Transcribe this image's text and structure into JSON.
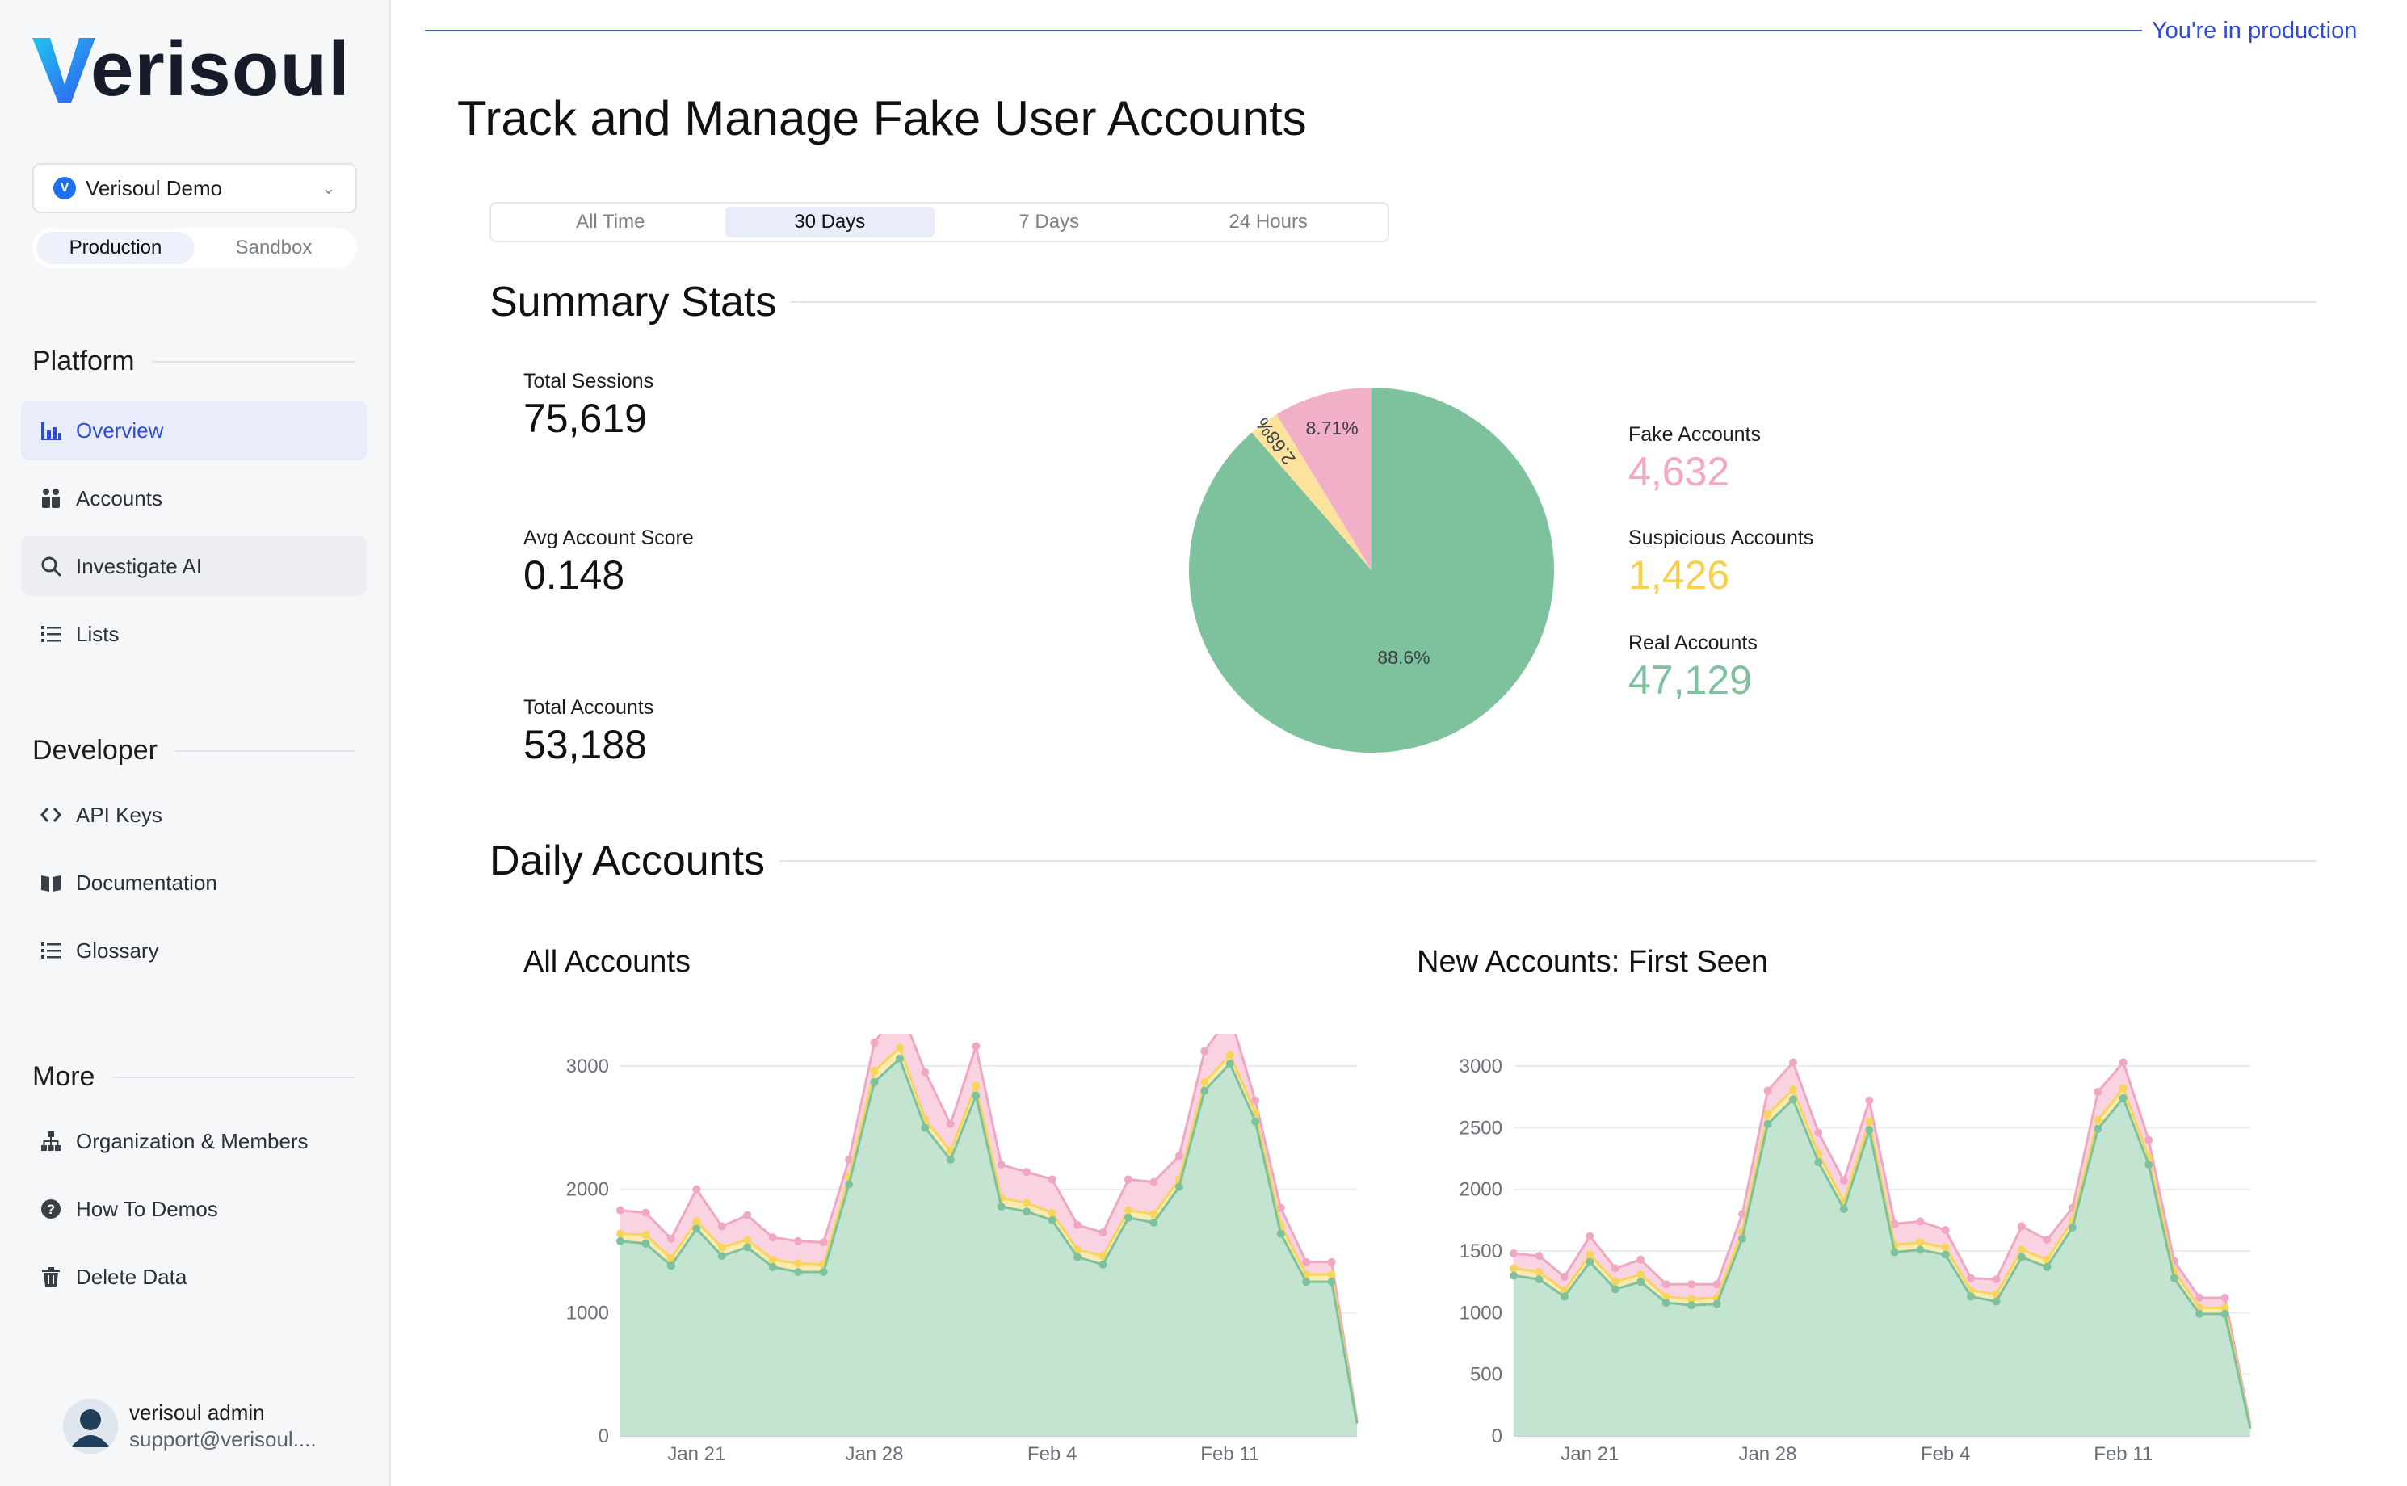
{
  "brand": {
    "logo_text": "erisoul",
    "logo_letter": "V"
  },
  "org_selector": {
    "name": "Verisoul Demo",
    "logo_letter": "V"
  },
  "environment": {
    "options": [
      "Production",
      "Sandbox"
    ],
    "selected": "Production"
  },
  "sidebar": {
    "platform": {
      "heading": "Platform",
      "items": [
        {
          "label": "Overview",
          "icon": "bar-chart-icon"
        },
        {
          "label": "Accounts",
          "icon": "users-icon"
        },
        {
          "label": "Investigate AI",
          "icon": "search-icon"
        },
        {
          "label": "Lists",
          "icon": "list-icon"
        }
      ]
    },
    "developer": {
      "heading": "Developer",
      "items": [
        {
          "label": "API Keys",
          "icon": "code-icon"
        },
        {
          "label": "Documentation",
          "icon": "book-icon"
        },
        {
          "label": "Glossary",
          "icon": "list-icon"
        }
      ]
    },
    "more": {
      "heading": "More",
      "items": [
        {
          "label": "Organization & Members",
          "icon": "org-chart-icon"
        },
        {
          "label": "How To Demos",
          "icon": "help-icon"
        },
        {
          "label": "Delete Data",
          "icon": "trash-icon"
        }
      ]
    },
    "active_item": "Overview",
    "user": {
      "name": "verisoul admin",
      "email": "support@verisoul...."
    }
  },
  "banner": {
    "text": "You're in production"
  },
  "page": {
    "title": "Track and Manage Fake User Accounts"
  },
  "time_tabs": {
    "items": [
      "All Time",
      "30 Days",
      "7 Days",
      "24 Hours"
    ],
    "selected": "30 Days"
  },
  "summary": {
    "title": "Summary Stats",
    "stats": [
      {
        "label": "Total Sessions",
        "value": "75,619"
      },
      {
        "label": "Avg Account Score",
        "value": "0.148"
      },
      {
        "label": "Total Accounts",
        "value": "53,188"
      }
    ],
    "legend": [
      {
        "label": "Fake Accounts",
        "value": "4,632",
        "color": "#f2a7c3"
      },
      {
        "label": "Suspicious Accounts",
        "value": "1,426",
        "color": "#f5cf4e"
      },
      {
        "label": "Real Accounts",
        "value": "47,129",
        "color": "#7dc29d"
      }
    ]
  },
  "daily": {
    "title": "Daily Accounts"
  },
  "colors": {
    "fake": "#f0a7c4",
    "suspicious": "#f7d55a",
    "real": "#7dc29d",
    "accent": "#2f4bd6"
  },
  "chart_data": [
    {
      "type": "pie",
      "labels": [
        "Real Accounts",
        "Suspicious Accounts",
        "Fake Accounts"
      ],
      "values": [
        88.6,
        2.68,
        8.71
      ],
      "value_labels": [
        "88.6%",
        "2.68%",
        "8.71%"
      ],
      "colors": [
        "#7dc29d",
        "#fbe39d",
        "#f2afc8"
      ]
    },
    {
      "type": "area",
      "title": "All Accounts",
      "stacked": true,
      "x_ticks": [
        "Jan 21",
        "Jan 28",
        "Feb  4",
        "Feb 11"
      ],
      "x_tick_index": [
        3,
        10,
        17,
        24
      ],
      "yticks": [
        "0",
        "1000",
        "2000",
        "3000"
      ],
      "ylim": [
        0,
        3000
      ],
      "ymax_plot": 3000,
      "series": [
        {
          "color": "#7dc29d",
          "values": [
            1580,
            1560,
            1380,
            1680,
            1460,
            1530,
            1370,
            1330,
            1330,
            2040,
            2870,
            3060,
            2500,
            2240,
            2760,
            1860,
            1820,
            1750,
            1450,
            1390,
            1770,
            1730,
            2020,
            2800,
            3020,
            2550,
            1640,
            1250,
            1250,
            100
          ]
        },
        {
          "color": "#f7d55a",
          "values": [
            60,
            70,
            60,
            60,
            70,
            60,
            60,
            70,
            60,
            60,
            90,
            90,
            70,
            70,
            80,
            70,
            70,
            60,
            60,
            70,
            60,
            70,
            60,
            70,
            70,
            70,
            70,
            60,
            60,
            10
          ]
        },
        {
          "color": "#f0a7c4",
          "values": [
            190,
            180,
            160,
            260,
            170,
            200,
            180,
            180,
            180,
            140,
            230,
            330,
            380,
            220,
            320,
            270,
            250,
            270,
            200,
            190,
            250,
            260,
            190,
            250,
            320,
            100,
            140,
            100,
            100,
            20
          ]
        }
      ]
    },
    {
      "type": "area",
      "title": "New Accounts: First Seen",
      "stacked": true,
      "x_ticks": [
        "Jan 21",
        "Jan 28",
        "Feb  4",
        "Feb 11"
      ],
      "x_tick_index": [
        3,
        10,
        17,
        24
      ],
      "yticks": [
        "0",
        "500",
        "1000",
        "1500",
        "2000",
        "2500",
        "3000"
      ],
      "ylim": [
        0,
        3000
      ],
      "ymax_plot": 3000,
      "series": [
        {
          "color": "#7dc29d",
          "values": [
            1300,
            1270,
            1130,
            1410,
            1190,
            1250,
            1080,
            1060,
            1070,
            1600,
            2530,
            2730,
            2220,
            1840,
            2480,
            1490,
            1510,
            1470,
            1130,
            1090,
            1450,
            1370,
            1690,
            2490,
            2740,
            2200,
            1280,
            990,
            990,
            60
          ]
        },
        {
          "color": "#f7d55a",
          "values": [
            60,
            60,
            50,
            60,
            60,
            60,
            50,
            50,
            50,
            60,
            80,
            80,
            70,
            60,
            70,
            60,
            60,
            60,
            50,
            60,
            60,
            60,
            60,
            70,
            80,
            60,
            60,
            50,
            50,
            10
          ]
        },
        {
          "color": "#f0a7c4",
          "values": [
            120,
            130,
            110,
            150,
            110,
            120,
            100,
            120,
            110,
            140,
            190,
            220,
            170,
            170,
            170,
            170,
            170,
            140,
            100,
            120,
            190,
            160,
            100,
            230,
            210,
            140,
            80,
            80,
            80,
            20
          ]
        }
      ]
    }
  ]
}
